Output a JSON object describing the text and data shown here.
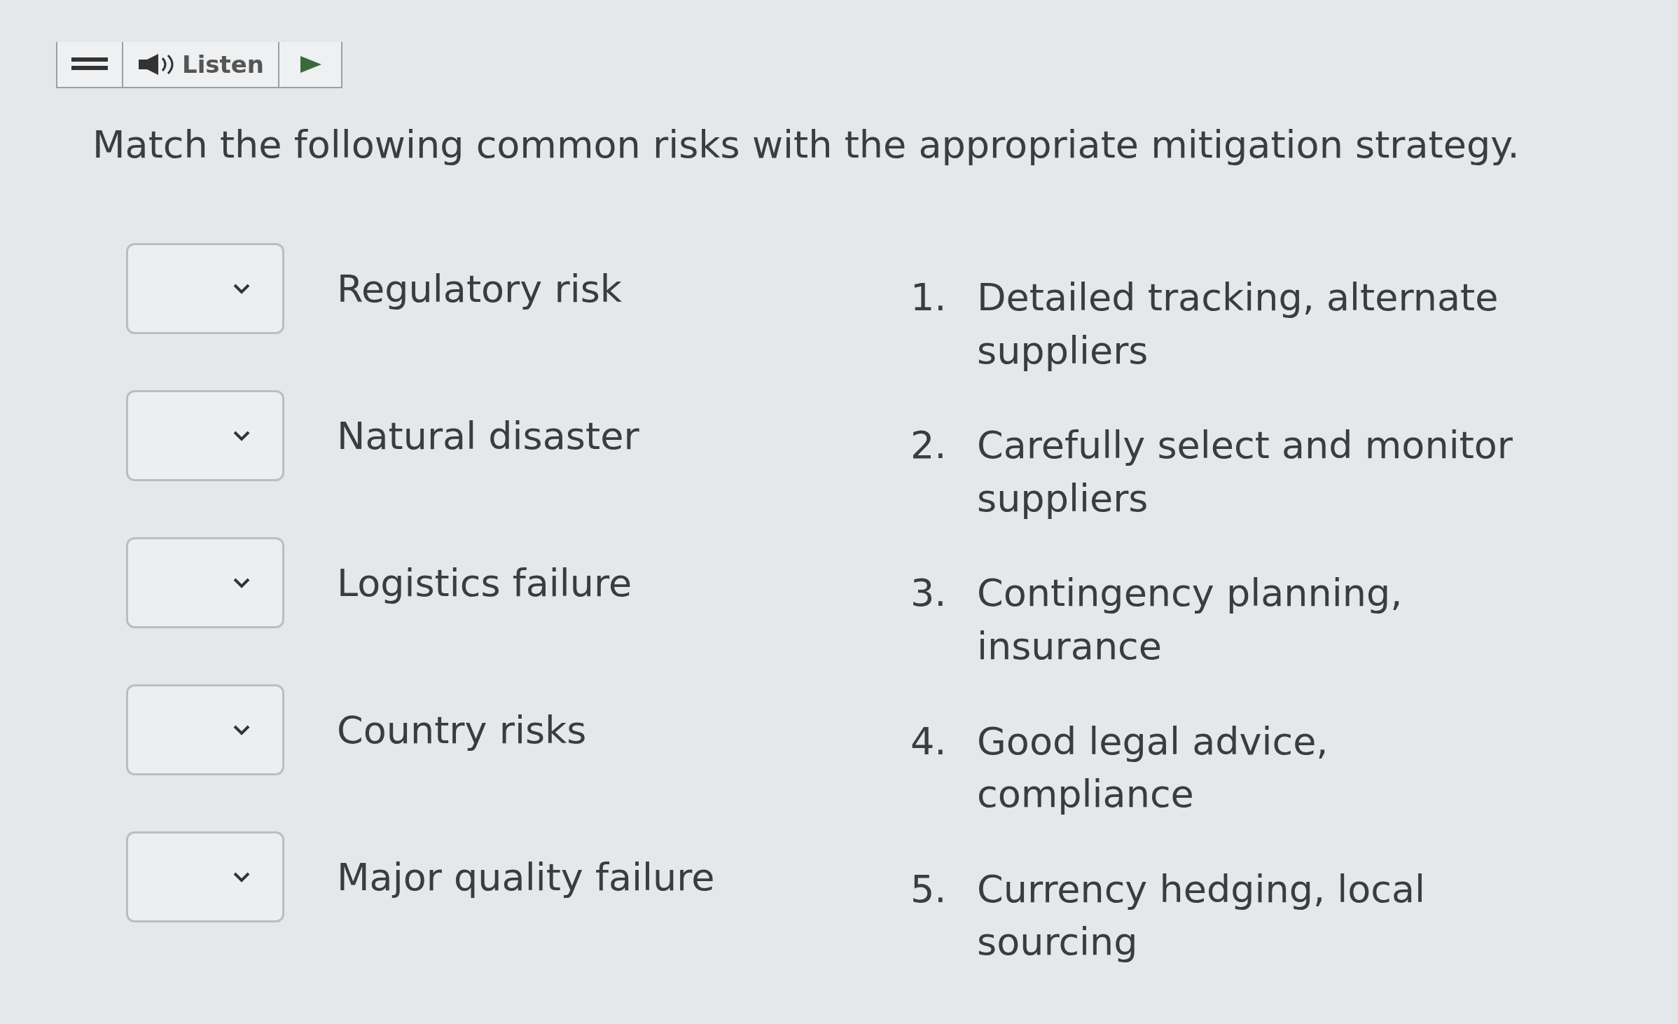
{
  "toolbar": {
    "listen_label": "Listen"
  },
  "question": "Match the following common risks with the appropriate mitigation strategy.",
  "risks": [
    {
      "label": "Regulatory risk"
    },
    {
      "label": "Natural disaster"
    },
    {
      "label": "Logistics failure"
    },
    {
      "label": "Country risks"
    },
    {
      "label": "Major quality failure"
    }
  ],
  "strategies": [
    {
      "number": "1.",
      "text": "Detailed tracking, alternate suppliers"
    },
    {
      "number": "2.",
      "text": "Carefully select and monitor suppliers"
    },
    {
      "number": "3.",
      "text": "Contingency planning, insurance"
    },
    {
      "number": "4.",
      "text": "Good legal advice, compliance"
    },
    {
      "number": "5.",
      "text": "Currency hedging, local sourcing"
    }
  ]
}
